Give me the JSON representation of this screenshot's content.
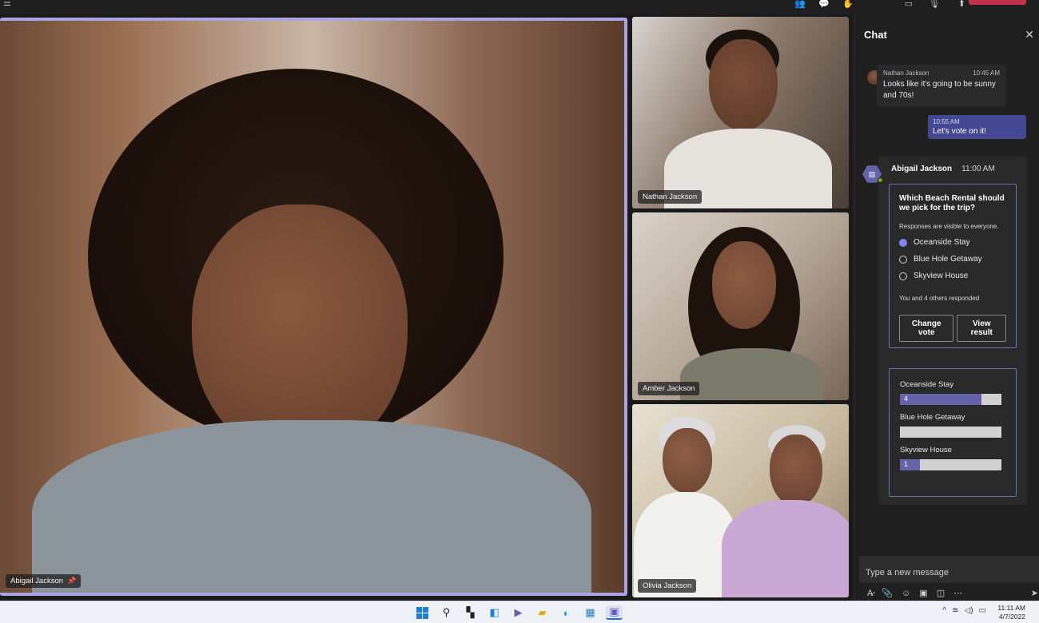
{
  "participants": {
    "main": {
      "name": "Abigail Jackson",
      "pinned_icon": "pin-icon"
    },
    "tiles": [
      {
        "name": "Nathan Jackson"
      },
      {
        "name": "Amber Jackson"
      },
      {
        "name": "Olivia Jackson"
      }
    ]
  },
  "chat": {
    "title": "Chat",
    "close_icon": "close-icon",
    "messages": [
      {
        "sender": "Nathan Jackson",
        "time": "10:45 AM",
        "text": "Looks like it's going to be sunny and 70s!"
      },
      {
        "time": "10:55 AM",
        "text": "Let's vote on it!"
      }
    ],
    "poll": {
      "sender": "Abigail Jackson",
      "time": "11:00 AM",
      "question": "Which Beach Rental should we pick for the trip?",
      "note": "Responses are visible to everyone.",
      "options": [
        {
          "label": "Oceanside Stay",
          "selected": true
        },
        {
          "label": "Blue Hole Getaway",
          "selected": false
        },
        {
          "label": "Skyview House",
          "selected": false
        }
      ],
      "responded": "You and 4 others responded",
      "change_vote": "Change vote",
      "view_result": "View result"
    },
    "results": [
      {
        "label": "Oceanside Stay",
        "count": "4",
        "fraction": 0.8
      },
      {
        "label": "Blue Hole Getaway",
        "count": "",
        "fraction": 0
      },
      {
        "label": "Skyview House",
        "count": "1",
        "fraction": 0.2
      }
    ],
    "compose_placeholder": "Type a new message"
  },
  "taskbar": {
    "time": "11:11 AM",
    "date": "4/7/2022"
  },
  "colors": {
    "accent": "#6264a7",
    "leave": "#c4314b",
    "selected_radio": "#7f85f5"
  }
}
